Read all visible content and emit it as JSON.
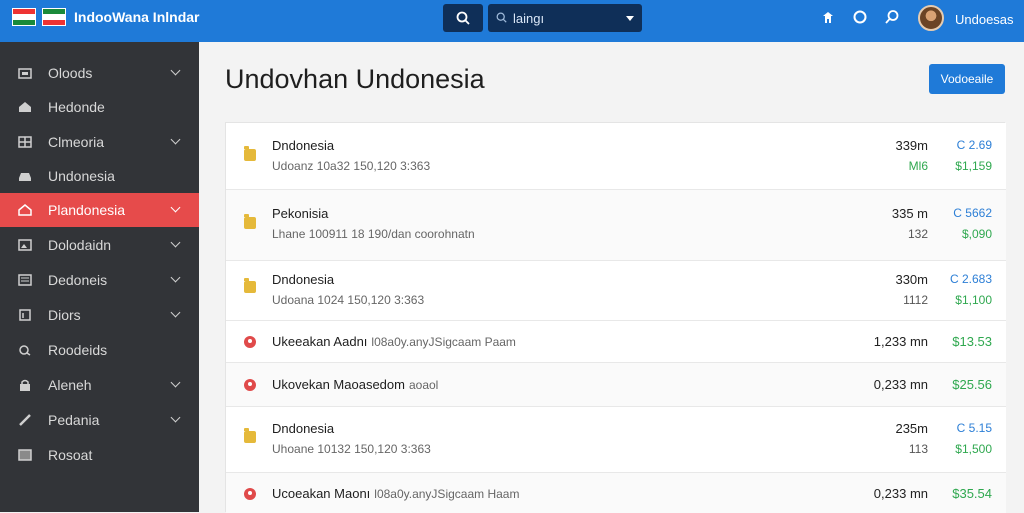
{
  "header": {
    "app_title": "IndooWana Inlndar",
    "search_value": "laingı",
    "user_name": "Undoesas",
    "colors": {
      "bar": "#1f7ad8",
      "search_bg": "#0f2f58"
    },
    "icons": [
      "flag-icon-left",
      "flag-icon-right",
      "search-icon",
      "dropdown-icon",
      "pin-icon",
      "notifications-icon",
      "search-icon-2",
      "user-avatar"
    ]
  },
  "sidebar": {
    "items": [
      {
        "label": "Oloods",
        "icon": "folder-icon"
      },
      {
        "label": "Hedonde",
        "icon": "home-icon"
      },
      {
        "label": "Clmeoria",
        "icon": "grid-icon"
      },
      {
        "label": "Undonesia",
        "icon": "car-icon"
      },
      {
        "label": "Plandonesia",
        "icon": "house-icon"
      },
      {
        "label": "Dolodaidn",
        "icon": "image-icon"
      },
      {
        "label": "Dedoneis",
        "icon": "list-icon"
      },
      {
        "label": "Diors",
        "icon": "document-icon"
      },
      {
        "label": "Roodeids",
        "icon": "search-icon"
      },
      {
        "label": "Aleneh",
        "icon": "lock-icon"
      },
      {
        "label": "Pedania",
        "icon": "pen-icon"
      },
      {
        "label": "Rosoat",
        "icon": "box-icon"
      }
    ],
    "active_label": "Plandonesia",
    "colors": {
      "background": "#323438",
      "active": "#e64b4b"
    }
  },
  "main": {
    "page_title": "Undovhan Undonesia",
    "primary_button": "Vodoeaile",
    "rows": [
      {
        "title": "Dndonesia",
        "subtitle": "Udoanz 10a32 150,120 3:363",
        "size": "339m",
        "size2": "Ml6",
        "value_blue": "C 2.69",
        "value_green": "$1,159",
        "icon": "folder-icon"
      },
      {
        "title": "Pekonisia",
        "subtitle": "Lhane 100911 18 190/dan coorohnatn",
        "size": "335 m",
        "size2": "132",
        "value_blue": "C 5662",
        "value_green": "$,090",
        "icon": "folder-icon"
      },
      {
        "title": "Dndonesia",
        "subtitle": "Udoana 1024 150,120 3:363",
        "size": "330m",
        "size2": "1112",
        "value_blue": "C 2.683",
        "value_green": "$1,100",
        "icon": "folder-icon"
      },
      {
        "title": "Ukeeakan Aadnı",
        "inline_sub": "l08a0y.anyJSigcaam Paam",
        "size": "1,233 mn",
        "value_green": "$13.53",
        "icon": "alert-icon"
      },
      {
        "title": "Ukovekan Maoasedom",
        "inline_sub": "aoaol",
        "size": "0,233 mn",
        "value_green": "$25.56",
        "icon": "alert-icon"
      },
      {
        "title": "Dndonesia",
        "subtitle": "Uhoane 10132 150,120 3:363",
        "size": "235m",
        "size2": "113",
        "value_blue": "C 5.15",
        "value_green": "$1,500",
        "icon": "folder-icon"
      },
      {
        "title": "Ucoeakan Maonı",
        "inline_sub": "l08a0y.anyJSigcaam Haam",
        "size": "0,233 mn",
        "value_green": "$35.54",
        "icon": "alert-icon"
      }
    ],
    "colors": {
      "blue": "#2d7fd6",
      "green": "#2fa84f",
      "folder": "#e5b93a",
      "alert": "#e04a4a"
    }
  }
}
